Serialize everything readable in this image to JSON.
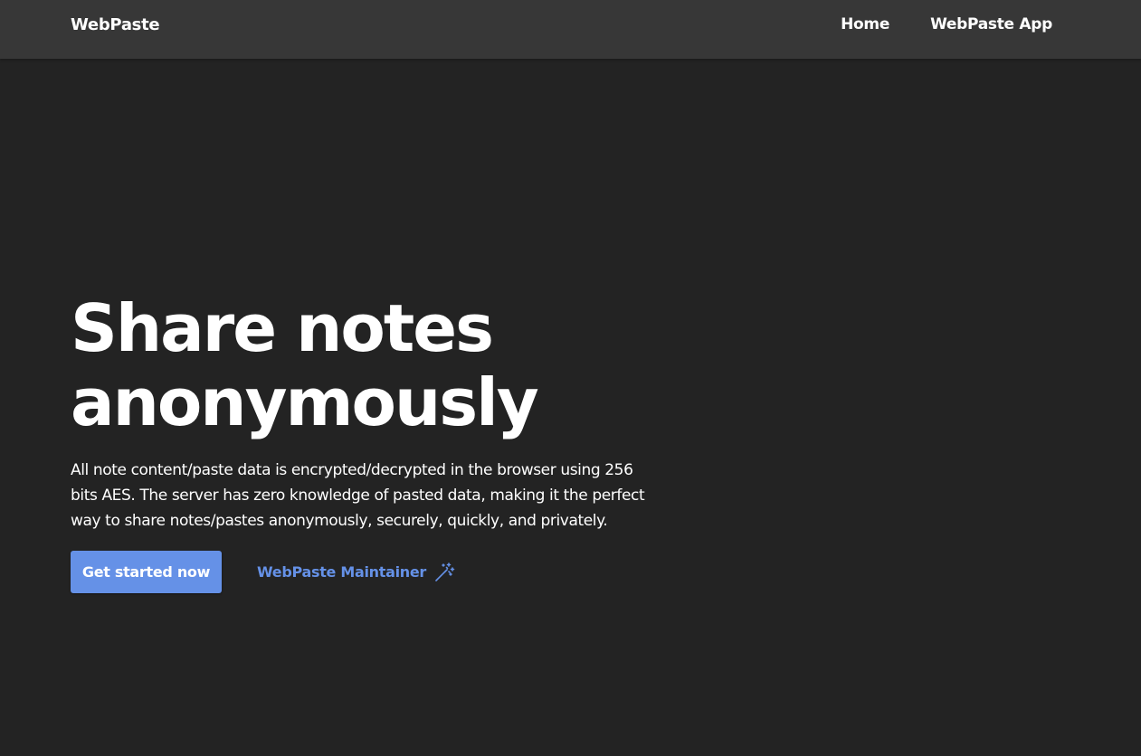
{
  "navbar": {
    "brand": "WebPaste",
    "links": [
      {
        "label": "Home"
      },
      {
        "label": "WebPaste App"
      }
    ]
  },
  "hero": {
    "title_line1": "Share notes",
    "title_line2": "anonymously",
    "description": "All note content/paste data is encrypted/decrypted in the browser using 256 bits AES. The server has zero knowledge of pasted data, making it the perfect way to share notes/pastes anonymously, securely, quickly, and privately."
  },
  "actions": {
    "primary_label": "Get started now",
    "secondary_label": "WebPaste Maintainer",
    "secondary_icon": "magic-wand-icon"
  },
  "colors": {
    "background": "#232323",
    "navbar": "#373737",
    "accent": "#6591e7",
    "text": "#ffffff"
  }
}
